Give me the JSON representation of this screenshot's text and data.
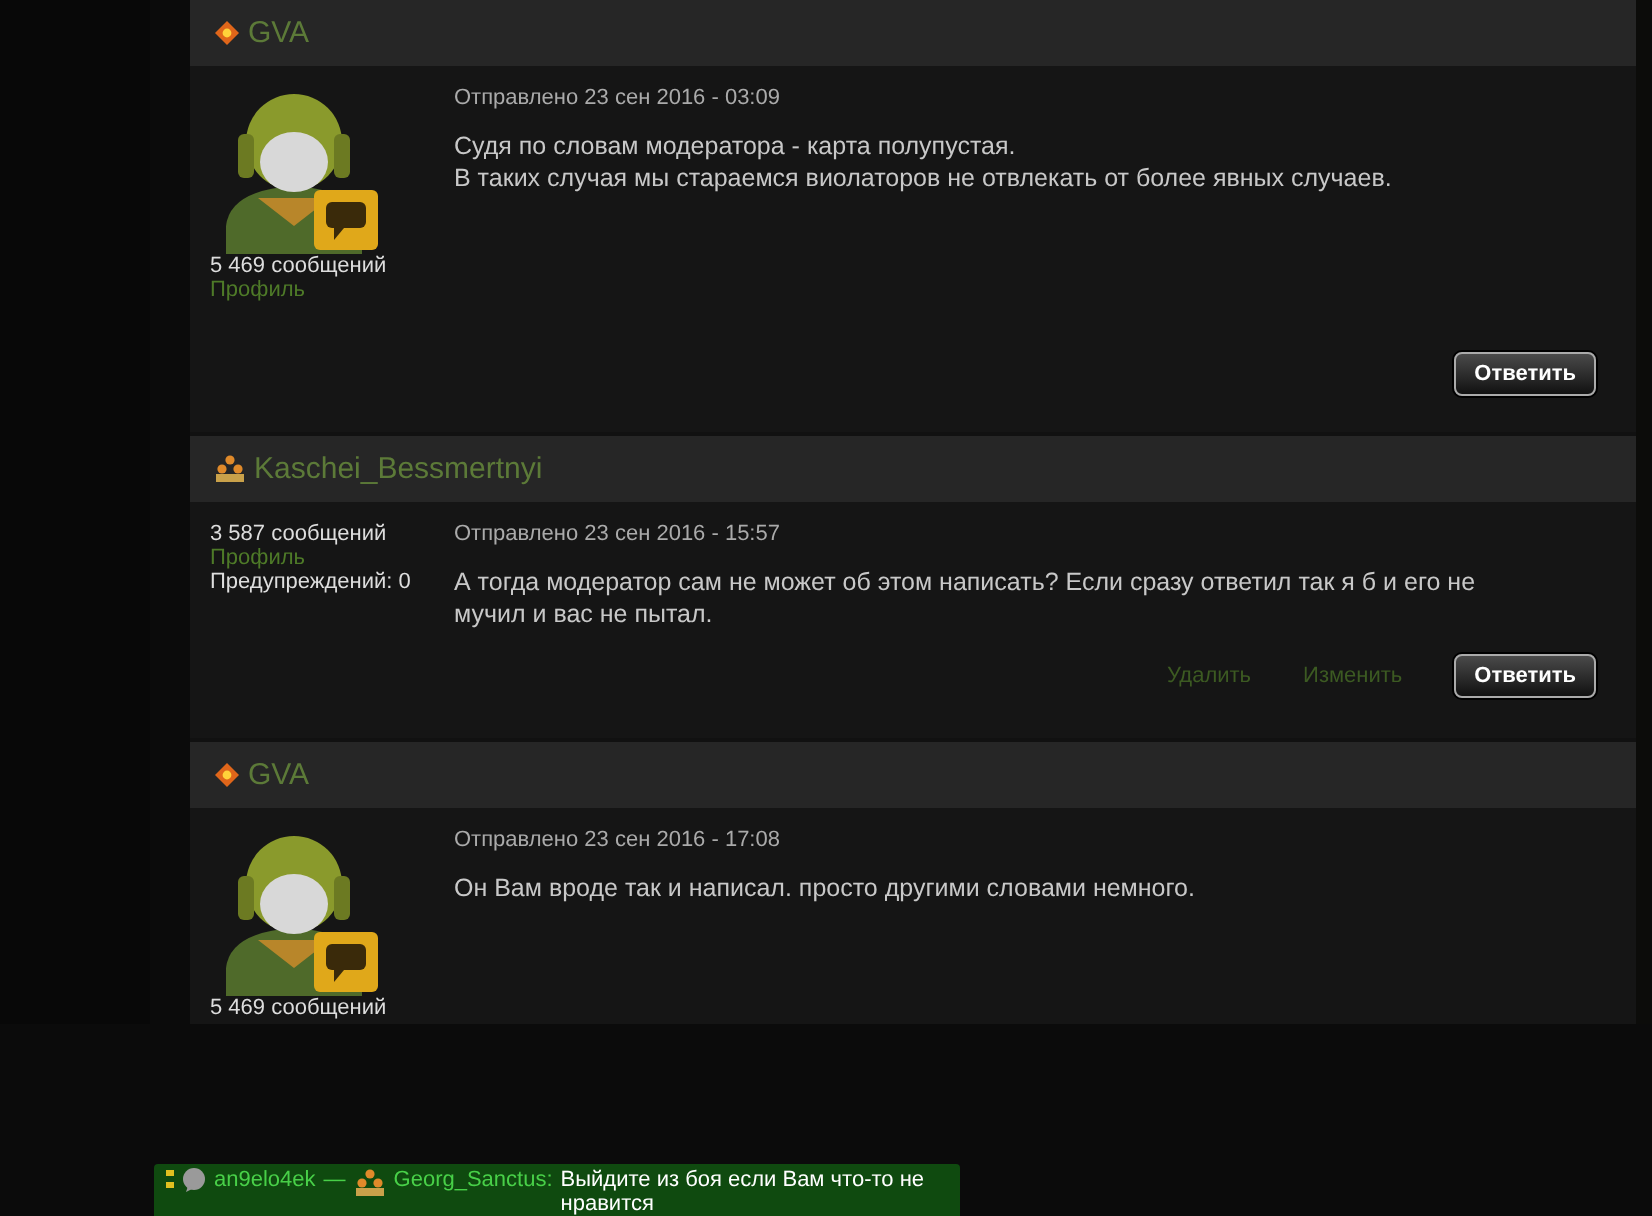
{
  "posts": [
    {
      "author": "GVA",
      "rank_icon": {
        "kind": "diamond"
      },
      "avatar": true,
      "messages": "5 469 сообщений",
      "profile": "Профиль",
      "date": "Отправлено 23 сен 2016 - 03:09",
      "text": [
        "Судя по словам модератора - карта полупустая.",
        "В таких случая мы стараемся виолаторов не отвлекать от более явных случаев."
      ],
      "actions": [
        {
          "kind": "button",
          "label": "Ответить"
        }
      ]
    },
    {
      "author": "Kaschei_Bessmertnyi",
      "rank_icon": {
        "kind": "stars"
      },
      "avatar": false,
      "messages": "3 587 сообщений",
      "profile": "Профиль",
      "warnings": "Предупреждений: 0",
      "date": "Отправлено 23 сен 2016 - 15:57",
      "text": [
        "А тогда модератор сам не может об этом написать? Если сразу ответил так я б и его не мучил и вас не пытал."
      ],
      "actions": [
        {
          "kind": "link",
          "label": "Удалить"
        },
        {
          "kind": "link",
          "label": "Изменить"
        },
        {
          "kind": "button",
          "label": "Ответить"
        }
      ]
    },
    {
      "author": "GVA",
      "rank_icon": {
        "kind": "diamond"
      },
      "avatar": true,
      "messages": "5 469 сообщений",
      "date": "Отправлено 23 сен 2016 - 17:08",
      "text": [
        "Он Вам вроде так и написал. просто другими словами немного."
      ]
    }
  ],
  "chat": {
    "sender": "an9elo4ek",
    "separator": "—",
    "recipient_rank_icon": {
      "kind": "stars"
    },
    "recipient": "Georg_Sanctus:",
    "message": "Выйдите из боя если Вам что-то не нравится"
  }
}
